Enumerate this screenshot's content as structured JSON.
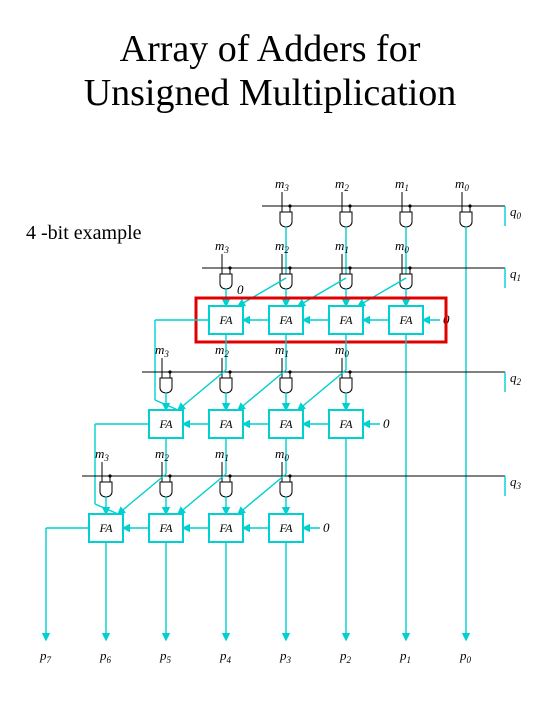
{
  "title_line1": "Array of Adders for",
  "title_line2": "Unsigned Multiplication",
  "subtitle": "4 -bit example",
  "fa_label": "FA",
  "zero_label": "0",
  "m_labels": [
    "m",
    "m",
    "m",
    "m"
  ],
  "m_sub": [
    "3",
    "2",
    "1",
    "0"
  ],
  "q_labels": [
    "q",
    "q",
    "q",
    "q"
  ],
  "q_sub": [
    "0",
    "1",
    "2",
    "3"
  ],
  "p_labels": [
    "p",
    "p",
    "p",
    "p",
    "p",
    "p",
    "p",
    "p"
  ],
  "p_sub": [
    "7",
    "6",
    "5",
    "4",
    "3",
    "2",
    "1",
    "0"
  ]
}
